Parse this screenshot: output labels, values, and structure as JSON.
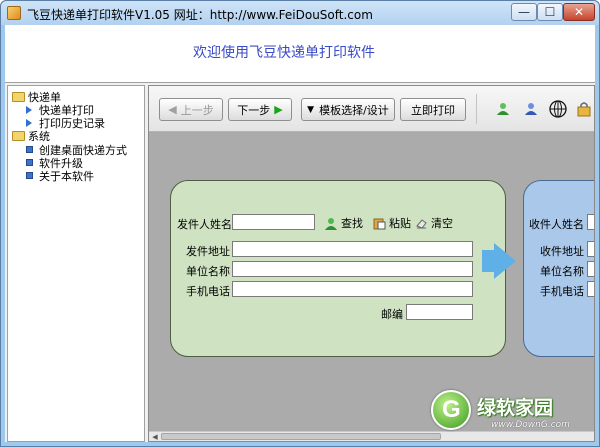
{
  "window": {
    "title": "飞豆快递单打印软件V1.05  网址：http://www.FeiDouSoft.com",
    "minimize": "—",
    "maximize": "☐",
    "close": "✕"
  },
  "banner": {
    "text": "欢迎使用飞豆快递单打印软件"
  },
  "tree": {
    "groups": [
      {
        "label": "快递单",
        "icon": "folder-icon",
        "items": [
          {
            "label": "快递单打印",
            "icon": "arrow-icon"
          },
          {
            "label": "打印历史记录",
            "icon": "arrow-icon"
          }
        ]
      },
      {
        "label": "系统",
        "icon": "folder-icon",
        "items": [
          {
            "label": "创建桌面快递方式",
            "icon": "square-icon"
          },
          {
            "label": "软件升级",
            "icon": "square-icon"
          },
          {
            "label": "关于本软件",
            "icon": "square-icon"
          }
        ]
      }
    ]
  },
  "toolbar": {
    "prev_label": "上一步",
    "next_label": "下一步",
    "template_label": "模板选择/设计",
    "print_label": "立即打印",
    "icons": [
      "user-green-icon",
      "user-blue-icon",
      "globe-icon",
      "lock-icon"
    ]
  },
  "sender": {
    "name_label": "发件人姓名",
    "find_label": "查找",
    "paste_label": "粘贴",
    "clear_label": "清空",
    "address_label": "发件地址",
    "company_label": "单位名称",
    "phone_label": "手机电话",
    "zip_label": "邮编",
    "name_value": "",
    "address_value": "",
    "company_value": "",
    "phone_value": "",
    "zip_value": ""
  },
  "receiver": {
    "name_label": "收件人姓名",
    "address_label": "收件地址",
    "company_label": "单位名称",
    "phone_label": "手机电话"
  },
  "watermark": {
    "text": "绿软家园",
    "sub": "www.DownG.com"
  },
  "colors": {
    "sender_card": "#cfe3c2",
    "receiver_card": "#a9c8ea",
    "banner_text": "#3a4bc6",
    "arrow": "#5fb0e6"
  }
}
